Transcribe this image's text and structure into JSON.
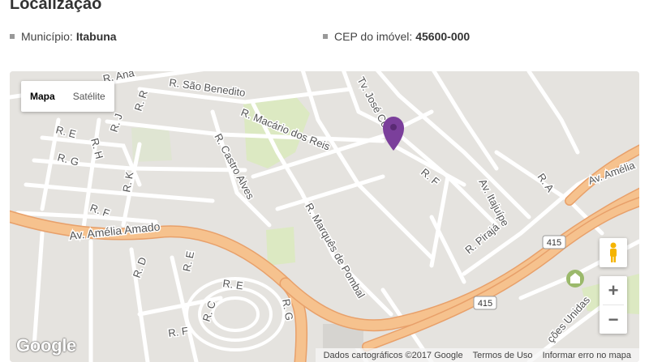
{
  "section": {
    "title": "Localização"
  },
  "info": {
    "municipio_label": "Município:",
    "municipio_value": "Itabuna",
    "cep_label": "CEP do imóvel:",
    "cep_value": "45600-000"
  },
  "map": {
    "type_buttons": {
      "map": "Mapa",
      "satellite": "Satélite"
    },
    "zoom_in": "+",
    "zoom_out": "−",
    "logo": "Google",
    "attribution": {
      "data": "Dados cartográficos ©2017 Google",
      "terms": "Termos de Uso",
      "report": "Informar erro no mapa"
    },
    "street_labels": {
      "ana": "R. Ana",
      "sao_benedito": "R. São Benedito",
      "macario": "R. Macário dos Reis",
      "jose_coelho": "Tv. José Coelho",
      "castro_alves": "R. Castro Alves",
      "marques_pombal": "R. Marquês de Pombal",
      "amelia_amado": "Av. Amélia Amado",
      "amelia_right": "Av. Amélia",
      "itajuipe": "Av. Itajuípe",
      "piraja": "R. Pirajá",
      "r_a": "R. A",
      "r_f": "R. F",
      "r_f2": "R. F",
      "r_f3": "R. F",
      "r_e": "R. E",
      "r_e2": "R. E",
      "r_e3": "R. E",
      "r_h": "R. H",
      "r_g": "R. G",
      "r_g2": "R. G",
      "r_k": "R. K",
      "r_j": "R. J",
      "r_r": "R. R",
      "r_d": "R. D",
      "r_c": "R. C",
      "unidas": "ções Unidas",
      "shield1": "415",
      "shield2": "415"
    },
    "colors": {
      "background": "#e5e3df",
      "street": "#ffffff",
      "highway": "#f6c28e",
      "park": "#dce9c2",
      "marker": "#7b3f9b"
    }
  }
}
